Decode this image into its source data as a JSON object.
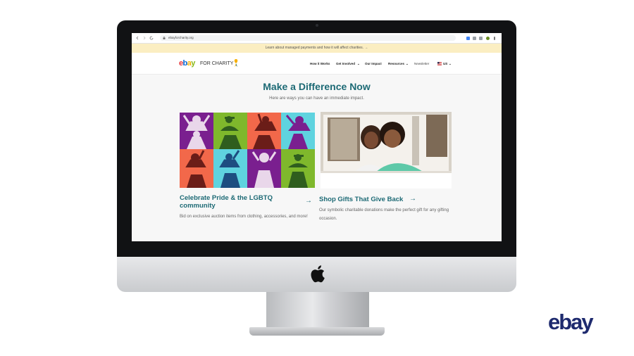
{
  "browser": {
    "url": "ebayforcharity.org"
  },
  "banner": {
    "text": "Learn about managed payments and how it will affect charities. →"
  },
  "site": {
    "logo_ebay": "ebay",
    "logo_sub": "FOR CHARITY",
    "nav": [
      {
        "label": "How it Works"
      },
      {
        "label": "Get Involved"
      },
      {
        "label": "Our Impact"
      },
      {
        "label": "Resources"
      },
      {
        "label": "Newsletter"
      },
      {
        "label": "US"
      }
    ]
  },
  "hero": {
    "title": "Make a Difference Now",
    "subtitle": "Here are ways you can have an immediate impact."
  },
  "cards": [
    {
      "title": "Celebrate Pride & the LGBTQ community",
      "desc": "Bid on exclusive auction items from clothing, accessories, and more!",
      "arrow": "→"
    },
    {
      "title": "Shop Gifts That Give Back",
      "desc": "Our symbolic charitable donations make the perfect gift for any gifting occasion.",
      "arrow": "→"
    }
  ],
  "brand": {
    "logo": "ebay"
  },
  "colors": {
    "accent": "#1d6a75",
    "banner": "#fbeec2",
    "ebay_red": "#e53238",
    "ebay_blue": "#0064d2",
    "ebay_yellow": "#f5af02",
    "ebay_green": "#86b817",
    "brand_navy": "#1e2a6e"
  }
}
